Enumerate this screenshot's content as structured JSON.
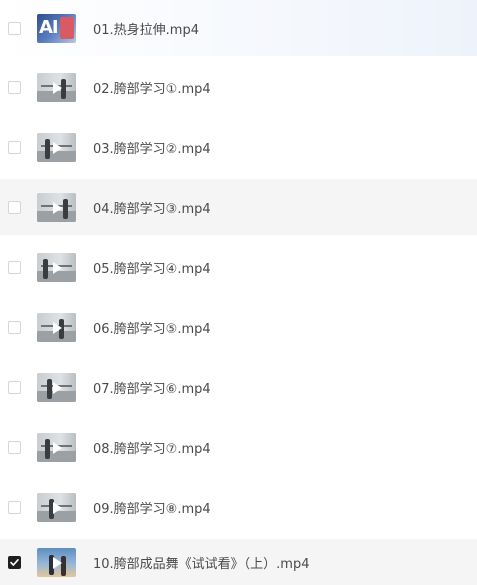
{
  "files": [
    {
      "name": "01.热身拉伸.mp4",
      "checked": false,
      "thumb_icon": "ai-intro-thumbnail",
      "logo_text": "AI"
    },
    {
      "name": "02.胯部学习①.mp4",
      "checked": false,
      "thumb_icon": "dance-studio-thumbnail"
    },
    {
      "name": "03.胯部学习②.mp4",
      "checked": false,
      "thumb_icon": "dance-studio-thumbnail"
    },
    {
      "name": "04.胯部学习③.mp4",
      "checked": false,
      "thumb_icon": "dance-studio-thumbnail"
    },
    {
      "name": "05.胯部学习④.mp4",
      "checked": false,
      "thumb_icon": "dance-studio-thumbnail"
    },
    {
      "name": "06.胯部学习⑤.mp4",
      "checked": false,
      "thumb_icon": "dance-studio-thumbnail"
    },
    {
      "name": "07.胯部学习⑥.mp4",
      "checked": false,
      "thumb_icon": "dance-studio-thumbnail"
    },
    {
      "name": "08.胯部学习⑦.mp4",
      "checked": false,
      "thumb_icon": "dance-studio-thumbnail"
    },
    {
      "name": "09.胯部学习⑧.mp4",
      "checked": false,
      "thumb_icon": "dance-studio-thumbnail"
    },
    {
      "name": "10.胯部成品舞《试试看》（上）.mp4",
      "checked": true,
      "thumb_icon": "stage-performance-thumbnail"
    }
  ],
  "colors": {
    "row_hover": "#f5f5f5",
    "checkbox_checked": "#1f1f1f",
    "text": "#4a4a4a"
  }
}
